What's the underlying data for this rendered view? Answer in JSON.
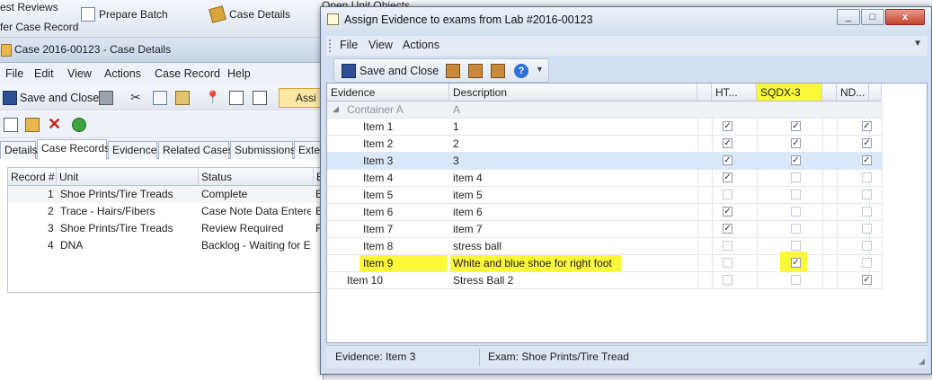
{
  "background": {
    "top_items": [
      "est Reviews",
      "fer Case Record",
      "Prepare Batch",
      "Case Details",
      "Open Unit Objects"
    ],
    "case_window": {
      "title": "Case 2016-00123 - Case Details",
      "menu": [
        "File",
        "Edit",
        "View",
        "Actions",
        "Case Record",
        "Help"
      ],
      "save_close": "Save and Close",
      "assign_partial": "Assi",
      "tabs": [
        "Details",
        "Case Records",
        "Evidence",
        "Related Cases",
        "Submissions",
        "Exter"
      ],
      "active_tab": 1,
      "grid_headers": [
        "Record #",
        "Unit",
        "Status",
        "E"
      ],
      "rows": [
        {
          "num": "1",
          "unit": "Shoe Prints/Tire Treads",
          "status": "Complete",
          "extra": "E"
        },
        {
          "num": "2",
          "unit": "Trace - Hairs/Fibers",
          "status": "Case Note Data Entered",
          "extra": "E"
        },
        {
          "num": "3",
          "unit": "Shoe Prints/Tire Treads",
          "status": "Review Required",
          "extra": "F"
        },
        {
          "num": "4",
          "unit": "DNA",
          "status": "Backlog - Waiting for E...",
          "extra": ""
        }
      ]
    }
  },
  "dialog": {
    "title": "Assign Evidence to exams from Lab #2016-00123",
    "window_buttons": [
      "_",
      "□",
      "x"
    ],
    "menu": [
      "File",
      "View",
      "Actions"
    ],
    "save_close": "Save and Close",
    "grid_headers": {
      "evidence": "Evidence",
      "description": "Description",
      "col1": "HT...",
      "col2": "SQDX-3",
      "col3": "ND..."
    },
    "group": {
      "evidence": "Container A",
      "description": "A"
    },
    "rows": [
      {
        "evidence": "Item 1",
        "description": "1",
        "c1": true,
        "c2": true,
        "c3": true
      },
      {
        "evidence": "Item 2",
        "description": "2",
        "c1": true,
        "c2": true,
        "c3": true
      },
      {
        "evidence": "Item 3",
        "description": "3",
        "c1": true,
        "c2": true,
        "c3": true
      },
      {
        "evidence": "Item 4",
        "description": "item 4",
        "c1": true,
        "c2": false,
        "c3": false
      },
      {
        "evidence": "Item 5",
        "description": "item 5",
        "c1": false,
        "c2": false,
        "c3": false
      },
      {
        "evidence": "Item 6",
        "description": "item 6",
        "c1": true,
        "c2": false,
        "c3": false
      },
      {
        "evidence": "Item 7",
        "description": "item 7",
        "c1": true,
        "c2": false,
        "c3": false
      },
      {
        "evidence": "Item 8",
        "description": "stress ball",
        "c1": false,
        "c2": false,
        "c3": false
      },
      {
        "evidence": "Item 9",
        "description": "White and blue shoe for right foot",
        "c1": false,
        "c2": true,
        "c3": false
      },
      {
        "evidence": "Item 10",
        "description": "Stress Ball 2",
        "c1": false,
        "c2": false,
        "c3": true
      }
    ],
    "selected_row": 2,
    "highlighted_row": 8,
    "status": {
      "evidence": "Evidence: Item 3",
      "exam": "Exam: Shoe Prints/Tire Tread"
    }
  },
  "colors": {
    "highlight": "#fbf83a",
    "selection": "#dbe8fa"
  }
}
